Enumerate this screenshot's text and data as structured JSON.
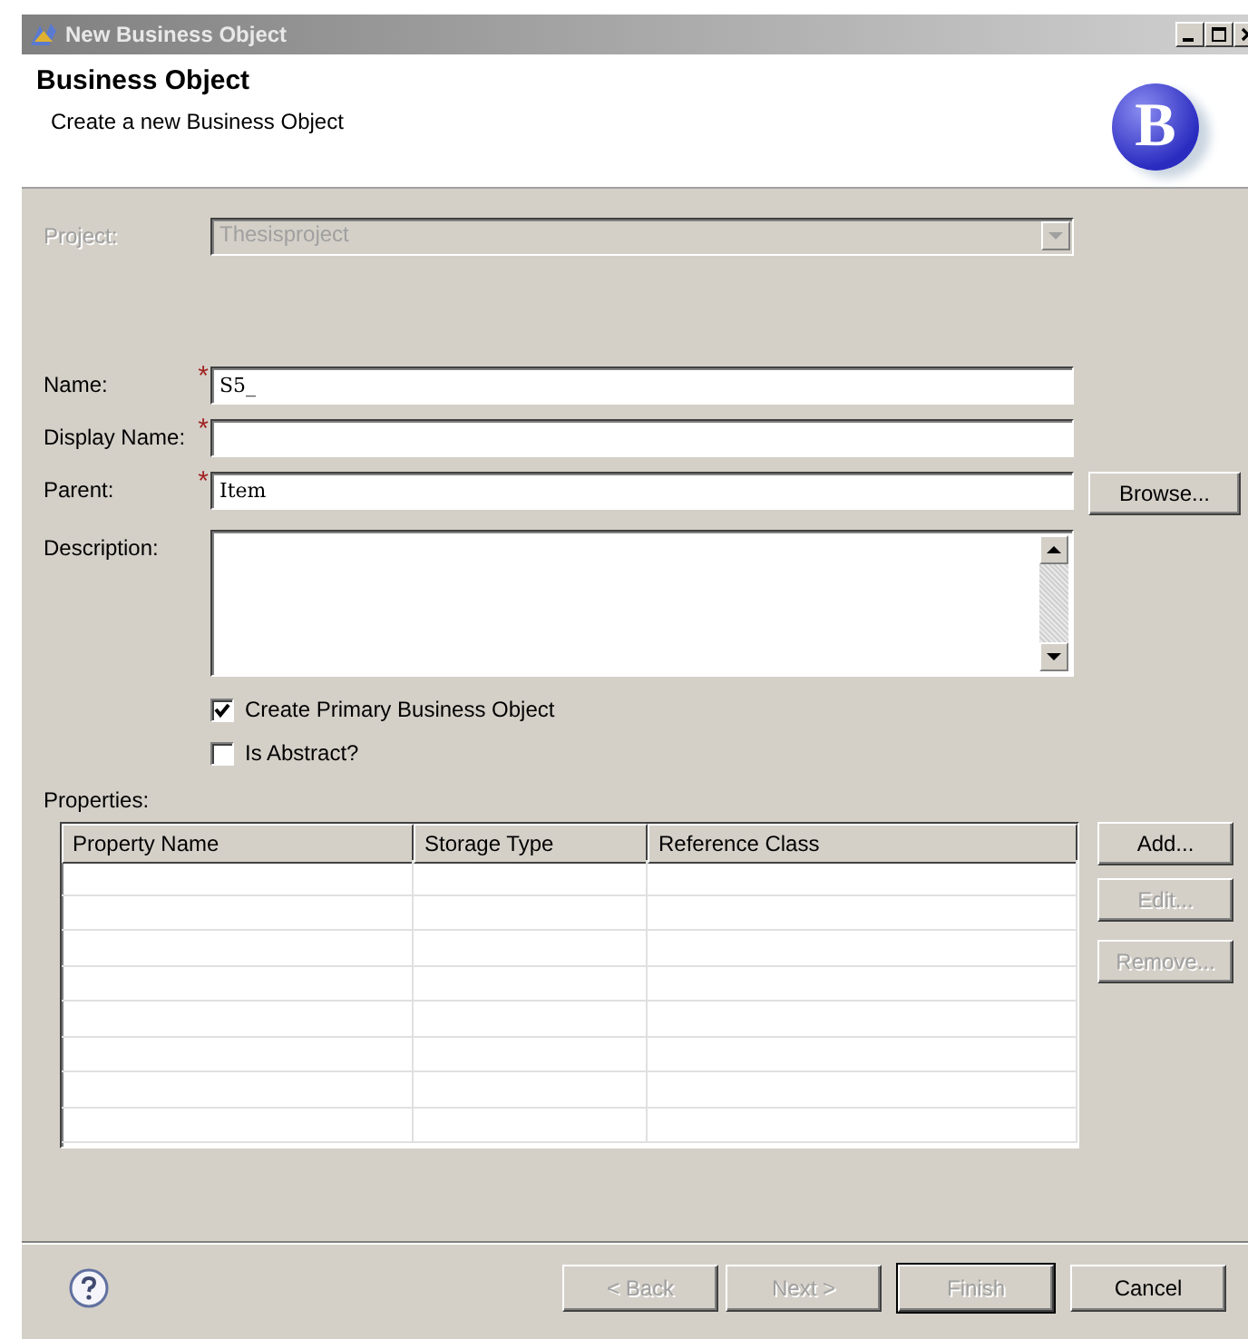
{
  "window": {
    "title": "New Business Object"
  },
  "header": {
    "title": "Business Object",
    "description": "Create a new Business Object",
    "logo": "B"
  },
  "required_mark": "*",
  "fields": [
    {
      "kind": "combo",
      "label": "Project:",
      "value": "Thesisproject",
      "disabled": true,
      "required": false
    },
    {
      "kind": "text",
      "label": "Name:",
      "value": "S5_",
      "disabled": false,
      "required": true
    },
    {
      "kind": "text",
      "label": "Display Name:",
      "disabled": false,
      "required": true
    },
    {
      "kind": "text",
      "label": "Parent:",
      "value": "Item",
      "disabled": false,
      "required": true,
      "button": "Browse..."
    },
    {
      "kind": "textarea",
      "label": "Description:",
      "disabled": false,
      "required": false
    }
  ],
  "checkboxes": [
    {
      "label": "Create Primary Business Object",
      "checked": true
    },
    {
      "label": "Is Abstract?",
      "checked": false
    }
  ],
  "properties": {
    "label": "Properties:",
    "columns": [
      "Property Name",
      "Storage Type",
      "Reference Class"
    ],
    "buttons": [
      {
        "label": "Add...",
        "disabled": false
      },
      {
        "label": "Edit...",
        "disabled": true
      },
      {
        "label": "Remove...",
        "disabled": true
      }
    ]
  },
  "footer": {
    "buttons": [
      {
        "label": "< Back",
        "disabled": true,
        "default": false
      },
      {
        "label": "Next >",
        "disabled": true,
        "default": false
      },
      {
        "label": "Finish",
        "disabled": true,
        "default": true
      },
      {
        "label": "Cancel",
        "disabled": false,
        "default": false
      }
    ]
  }
}
